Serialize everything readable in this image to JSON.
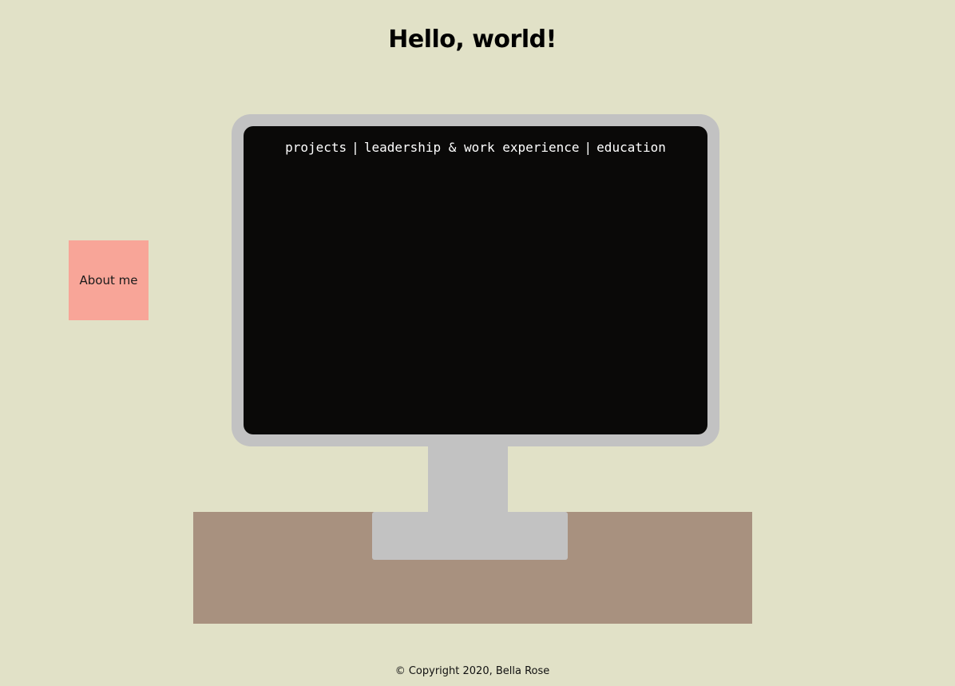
{
  "header": {
    "title": "Hello, world!"
  },
  "sidebar": {
    "about_label": "About me"
  },
  "monitor": {
    "nav": [
      {
        "label": "projects"
      },
      {
        "label": "leadership & work experience"
      },
      {
        "label": "education"
      }
    ],
    "separator": "|"
  },
  "footer": {
    "copyright": "© Copyright 2020, Bella Rose"
  },
  "colors": {
    "background": "#e1e1c7",
    "note": "#f8a598",
    "monitor_frame": "#c2c2c2",
    "screen": "#0a0908",
    "desk": "#a8917f"
  }
}
